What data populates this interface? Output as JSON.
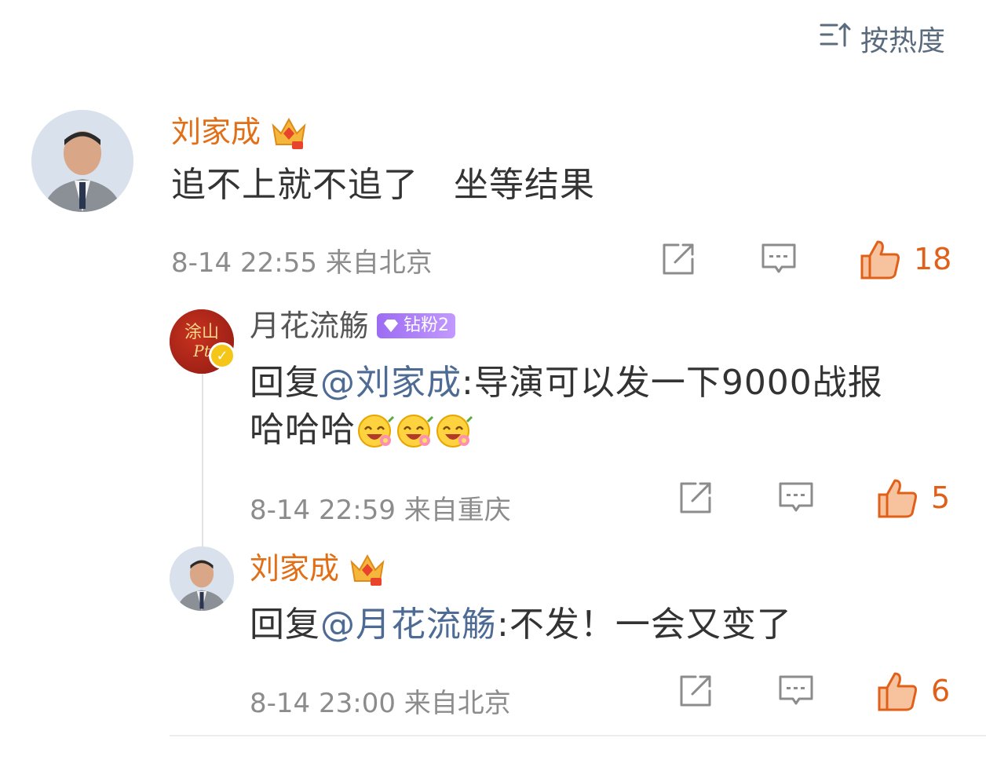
{
  "sort": {
    "icon": "sort-icon",
    "label": "按热度"
  },
  "comments": [
    {
      "author": "刘家成",
      "author_badge": "crown-icon",
      "text": "追不上就不追了　坐等结果",
      "time": "8-14 22:55",
      "location": "来自北京",
      "likes": "18",
      "replies": [
        {
          "author": "月花流觞",
          "avatar_text_top": "涂山",
          "avatar_text_bottom": "Pt",
          "fan_badge": "钻粉2",
          "reply_prefix": "回复",
          "mention": "@刘家成",
          "text_after": ":导演可以发一下9000战报",
          "text_line2": "哈哈哈",
          "emoji": "laughing-flower-emoji",
          "time": "8-14 22:59",
          "location": "来自重庆",
          "likes": "5"
        },
        {
          "author": "刘家成",
          "author_badge": "crown-icon",
          "reply_prefix": "回复",
          "mention": "@月花流觞",
          "text_after": ":不发！一会又变了",
          "time": "8-14 23:00",
          "location": "来自北京",
          "likes": "6"
        }
      ]
    }
  ],
  "colors": {
    "accent_orange": "#e26e16",
    "mention_blue": "#4d6b94",
    "fan_badge_purple": "#9c6cf2",
    "meta_gray": "#8c8c8c"
  }
}
